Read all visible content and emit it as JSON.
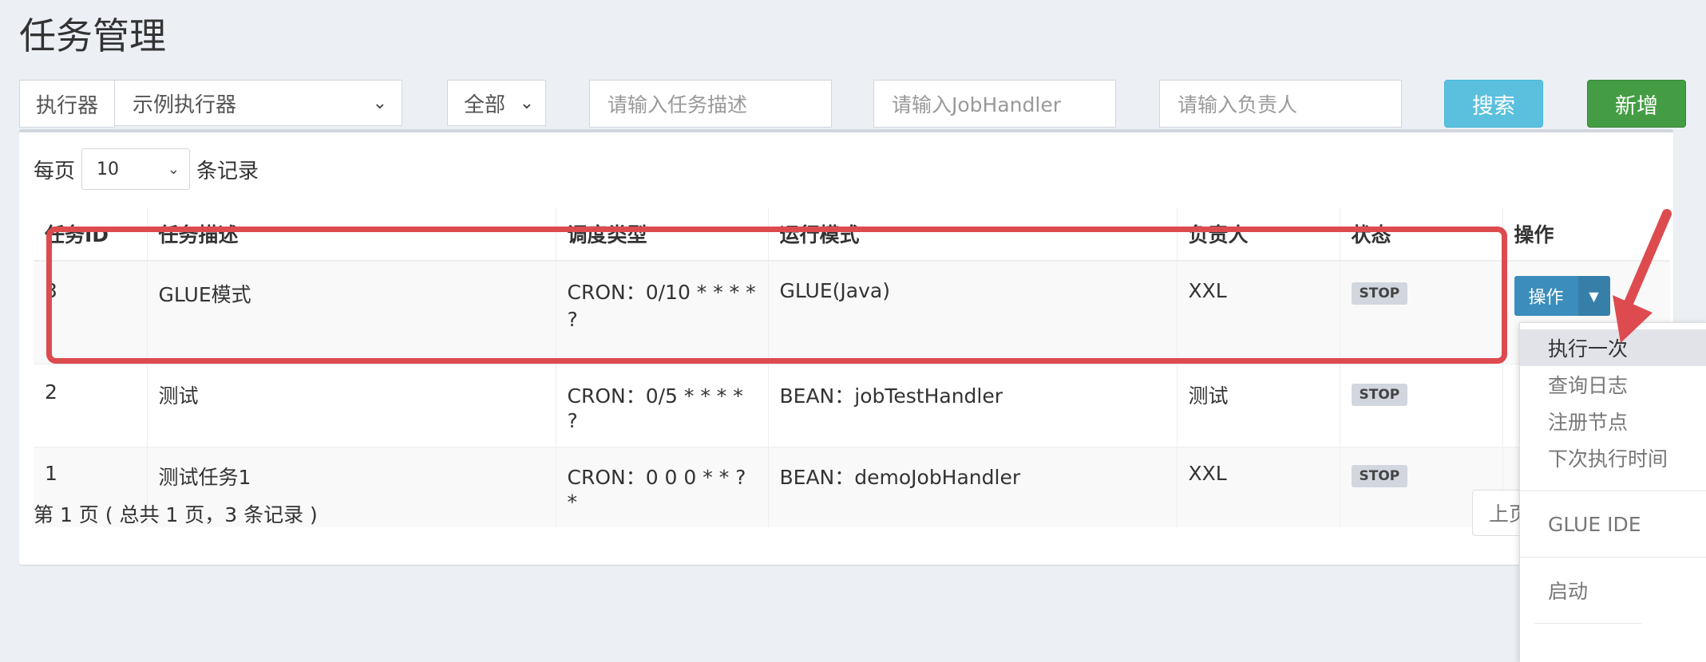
{
  "page": {
    "title": "任务管理"
  },
  "filters": {
    "executor_label": "执行器",
    "executor_value": "示例执行器",
    "status_value": "全部",
    "desc_placeholder": "请输入任务描述",
    "handler_placeholder": "请输入JobHandler",
    "owner_placeholder": "请输入负责人",
    "search_label": "搜索",
    "add_label": "新增"
  },
  "pager": {
    "per_page_prefix": "每页",
    "per_page_value": "10",
    "per_page_suffix": "条记录",
    "info": "第 1 页 ( 总共 1 页，3 条记录 )",
    "prev_label": "上页"
  },
  "table": {
    "headers": [
      "任务ID",
      "任务描述",
      "调度类型",
      "运行模式",
      "负责人",
      "状态",
      "操作"
    ],
    "rows": [
      {
        "id": "3",
        "desc": "GLUE模式",
        "schedule": "CRON：0/10 * * * * ?",
        "mode": "GLUE(Java)",
        "owner": "XXL",
        "status": "STOP"
      },
      {
        "id": "2",
        "desc": "测试",
        "schedule": "CRON：0/5 * * * * ?",
        "mode": "BEAN：jobTestHandler",
        "owner": "测试",
        "status": "STOP"
      },
      {
        "id": "1",
        "desc": "测试任务1",
        "schedule": "CRON：0 0 0 * * ? *",
        "mode": "BEAN：demoJobHandler",
        "owner": "XXL",
        "status": "STOP"
      }
    ],
    "action_label": "操作"
  },
  "dropdown": {
    "items": [
      "执行一次",
      "查询日志",
      "注册节点",
      "下次执行时间",
      "GLUE IDE",
      "启动"
    ]
  },
  "colors": {
    "highlight": "#dd4b4f",
    "primary": "#3c8dbc",
    "info": "#5bc0de",
    "success": "#449d44"
  }
}
